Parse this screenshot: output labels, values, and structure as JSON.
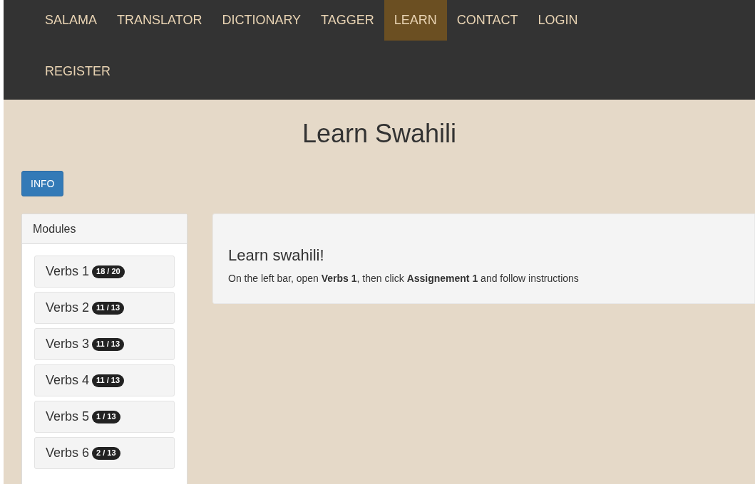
{
  "nav": [
    {
      "label": "SALAMA",
      "selected": false
    },
    {
      "label": "TRANSLATOR",
      "selected": false
    },
    {
      "label": "DICTIONARY",
      "selected": false
    },
    {
      "label": "TAGGER",
      "selected": false
    },
    {
      "label": "LEARN",
      "selected": true
    },
    {
      "label": "CONTACT",
      "selected": false
    },
    {
      "label": "LOGIN",
      "selected": false
    },
    {
      "label": "REGISTER",
      "selected": false
    }
  ],
  "title": "Learn Swahili",
  "info_button": "INFO",
  "modules": {
    "heading": "Modules",
    "items": [
      {
        "label": "Verbs 1",
        "badge": "18 / 20"
      },
      {
        "label": "Verbs 2",
        "badge": "11 / 13"
      },
      {
        "label": "Verbs 3",
        "badge": "11 / 13"
      },
      {
        "label": "Verbs 4",
        "badge": "11 / 13"
      },
      {
        "label": "Verbs 5",
        "badge": "1 / 13"
      },
      {
        "label": "Verbs 6",
        "badge": "2 / 13"
      }
    ]
  },
  "content": {
    "heading": "Learn swahili!",
    "text": "On the left bar, open **Verbs 1**, then click **Assignement 1** and follow instructions"
  }
}
